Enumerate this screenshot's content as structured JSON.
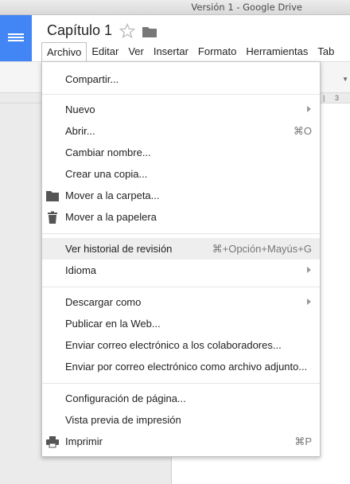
{
  "window": {
    "title": "Versión 1 - Google Drive"
  },
  "document": {
    "title": "Capítulo 1"
  },
  "colors": {
    "brand": "#4285f4",
    "highlight": "#eeeeee"
  },
  "menubar": {
    "items": [
      "Archivo",
      "Editar",
      "Ver",
      "Insertar",
      "Formato",
      "Herramientas",
      "Tab"
    ]
  },
  "ruler": {
    "marker": "3"
  },
  "file_menu": {
    "share": "Compartir...",
    "new": "Nuevo",
    "open": "Abrir...",
    "open_shortcut": "⌘O",
    "rename": "Cambiar nombre...",
    "make_copy": "Crear una copia...",
    "move_to_folder": "Mover a la carpeta...",
    "move_to_trash": "Mover a la papelera",
    "revision_history": "Ver historial de revisión",
    "revision_history_shortcut": "⌘+Opción+Mayús+G",
    "language": "Idioma",
    "download_as": "Descargar como",
    "publish": "Publicar en la Web...",
    "email_collaborators": "Enviar correo electrónico a los colaboradores...",
    "email_attachment": "Enviar por correo electrónico como archivo adjunto...",
    "page_setup": "Configuración de página...",
    "print_preview": "Vista previa de impresión",
    "print": "Imprimir",
    "print_shortcut": "⌘P"
  }
}
